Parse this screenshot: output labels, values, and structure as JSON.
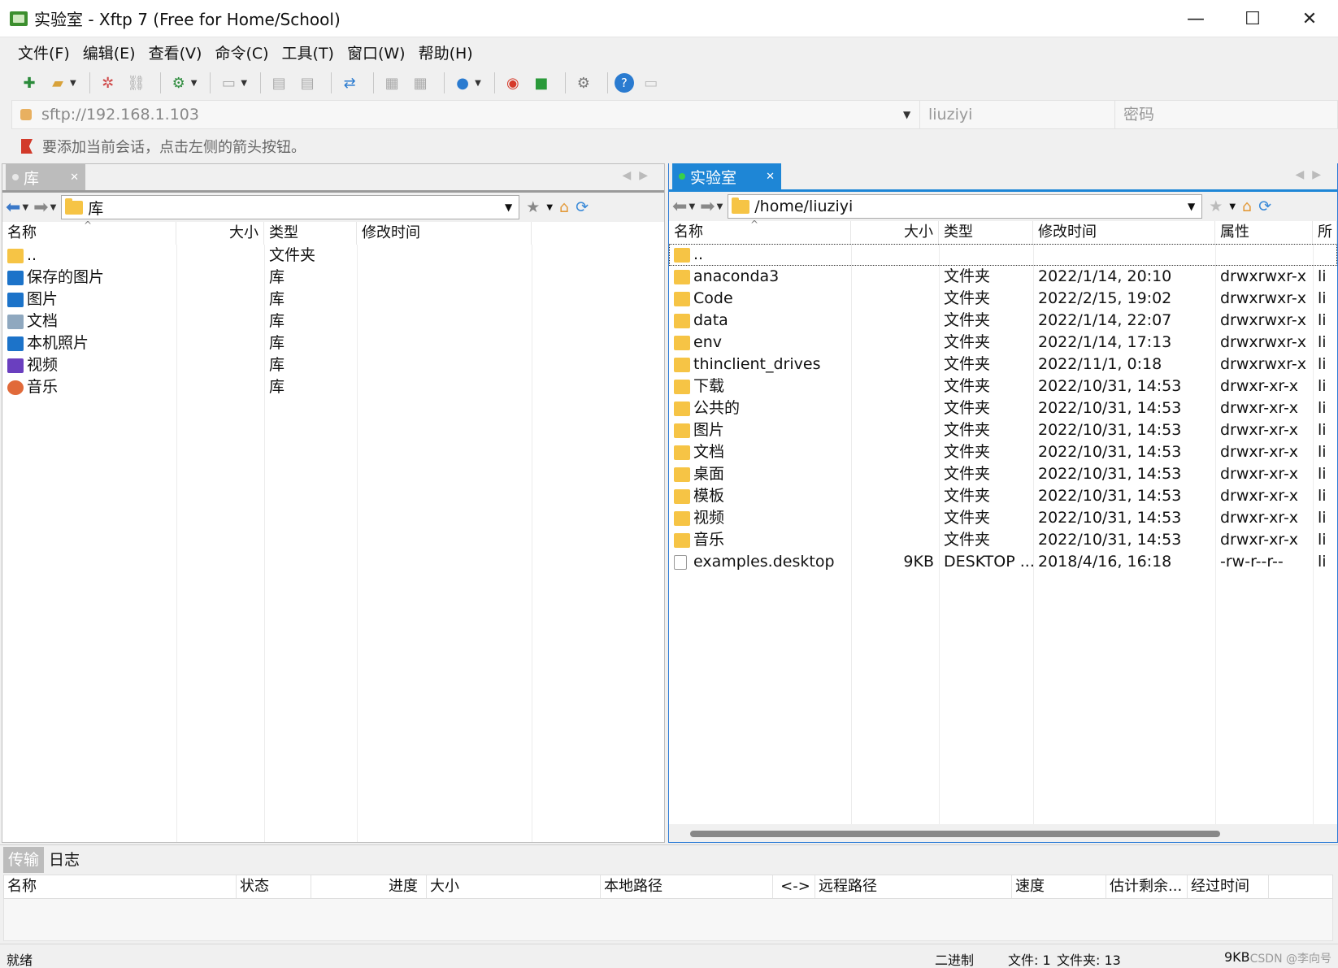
{
  "window": {
    "title": "实验室 - Xftp 7 (Free for Home/School)",
    "minimize_label": "—",
    "maximize_label": "☐",
    "close_label": "✕"
  },
  "menu": [
    "文件(F)",
    "编辑(E)",
    "查看(V)",
    "命令(C)",
    "工具(T)",
    "窗口(W)",
    "帮助(H)"
  ],
  "address": {
    "host": "sftp://192.168.1.103",
    "user_placeholder": "liuziyi",
    "password_placeholder": "密码"
  },
  "hint": "要添加当前会话，点击左侧的箭头按钮。",
  "left": {
    "tab_label": "库",
    "path": "库",
    "columns": [
      "名称",
      "大小",
      "类型",
      "修改时间"
    ],
    "rows": [
      {
        "name": "..",
        "size": "",
        "type": "文件夹",
        "icon": "folder-icon"
      },
      {
        "name": "保存的图片",
        "size": "",
        "type": "库",
        "icon": "picture-icon"
      },
      {
        "name": "图片",
        "size": "",
        "type": "库",
        "icon": "picture-icon"
      },
      {
        "name": "文档",
        "size": "",
        "type": "库",
        "icon": "document-icon"
      },
      {
        "name": "本机照片",
        "size": "",
        "type": "库",
        "icon": "picture-icon"
      },
      {
        "name": "视频",
        "size": "",
        "type": "库",
        "icon": "video-icon"
      },
      {
        "name": "音乐",
        "size": "",
        "type": "库",
        "icon": "music-icon"
      }
    ]
  },
  "right": {
    "tab_label": "实验室",
    "path": "/home/liuziyi",
    "columns": [
      "名称",
      "大小",
      "类型",
      "修改时间",
      "属性",
      "所"
    ],
    "rows": [
      {
        "name": "..",
        "size": "",
        "type": "",
        "modified": "",
        "perm": "",
        "owner": "",
        "icon": "folder-icon"
      },
      {
        "name": "anaconda3",
        "size": "",
        "type": "文件夹",
        "modified": "2022/1/14, 20:10",
        "perm": "drwxrwxr-x",
        "owner": "li",
        "icon": "folder-icon"
      },
      {
        "name": "Code",
        "size": "",
        "type": "文件夹",
        "modified": "2022/2/15, 19:02",
        "perm": "drwxrwxr-x",
        "owner": "li",
        "icon": "folder-icon"
      },
      {
        "name": "data",
        "size": "",
        "type": "文件夹",
        "modified": "2022/1/14, 22:07",
        "perm": "drwxrwxr-x",
        "owner": "li",
        "icon": "folder-icon"
      },
      {
        "name": "env",
        "size": "",
        "type": "文件夹",
        "modified": "2022/1/14, 17:13",
        "perm": "drwxrwxr-x",
        "owner": "li",
        "icon": "folder-icon"
      },
      {
        "name": "thinclient_drives",
        "size": "",
        "type": "文件夹",
        "modified": "2022/11/1, 0:18",
        "perm": "drwxrwxr-x",
        "owner": "li",
        "icon": "folder-icon"
      },
      {
        "name": "下载",
        "size": "",
        "type": "文件夹",
        "modified": "2022/10/31, 14:53",
        "perm": "drwxr-xr-x",
        "owner": "li",
        "icon": "folder-icon"
      },
      {
        "name": "公共的",
        "size": "",
        "type": "文件夹",
        "modified": "2022/10/31, 14:53",
        "perm": "drwxr-xr-x",
        "owner": "li",
        "icon": "folder-icon"
      },
      {
        "name": "图片",
        "size": "",
        "type": "文件夹",
        "modified": "2022/10/31, 14:53",
        "perm": "drwxr-xr-x",
        "owner": "li",
        "icon": "folder-icon"
      },
      {
        "name": "文档",
        "size": "",
        "type": "文件夹",
        "modified": "2022/10/31, 14:53",
        "perm": "drwxr-xr-x",
        "owner": "li",
        "icon": "folder-icon"
      },
      {
        "name": "桌面",
        "size": "",
        "type": "文件夹",
        "modified": "2022/10/31, 14:53",
        "perm": "drwxr-xr-x",
        "owner": "li",
        "icon": "folder-icon"
      },
      {
        "name": "模板",
        "size": "",
        "type": "文件夹",
        "modified": "2022/10/31, 14:53",
        "perm": "drwxr-xr-x",
        "owner": "li",
        "icon": "folder-icon"
      },
      {
        "name": "视频",
        "size": "",
        "type": "文件夹",
        "modified": "2022/10/31, 14:53",
        "perm": "drwxr-xr-x",
        "owner": "li",
        "icon": "folder-icon"
      },
      {
        "name": "音乐",
        "size": "",
        "type": "文件夹",
        "modified": "2022/10/31, 14:53",
        "perm": "drwxr-xr-x",
        "owner": "li",
        "icon": "folder-icon"
      },
      {
        "name": "examples.desktop",
        "size": "9KB",
        "type": "DESKTOP ...",
        "modified": "2018/4/16, 16:18",
        "perm": "-rw-r--r--",
        "owner": "li",
        "icon": "file-icon"
      }
    ]
  },
  "transfer": {
    "tabs": [
      "传输",
      "日志"
    ],
    "columns": [
      "名称",
      "状态",
      "进度",
      "大小",
      "本地路径",
      "<->",
      "远程路径",
      "速度",
      "估计剩余...",
      "经过时间"
    ]
  },
  "status": {
    "ready": "就绪",
    "mode": "二进制",
    "files": "文件: 1",
    "folders": "文件夹: 13",
    "size": "9KB",
    "watermark": "CSDN @李向号"
  },
  "colors": {
    "tab_active": "#1e86d6",
    "tab_inactive": "#bcbcbc",
    "folder": "#f6c445"
  }
}
